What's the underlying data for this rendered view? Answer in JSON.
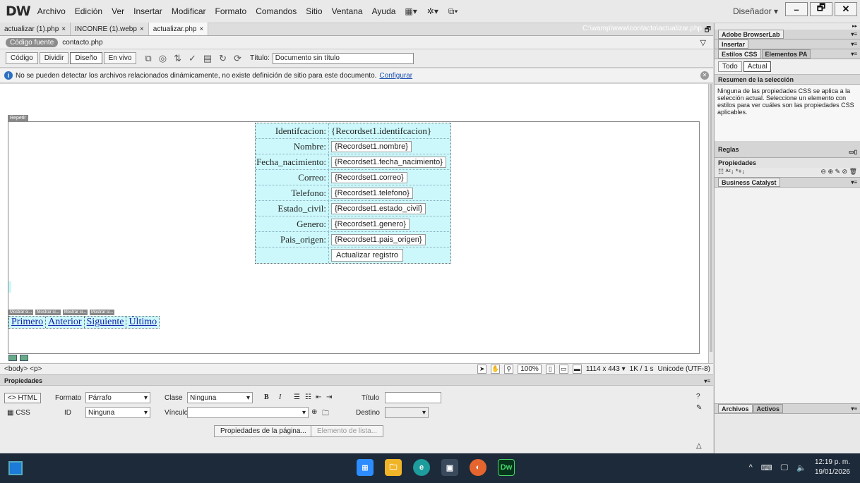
{
  "menubar": {
    "logo": "DW",
    "items": [
      "Archivo",
      "Edición",
      "Ver",
      "Insertar",
      "Modificar",
      "Formato",
      "Comandos",
      "Sitio",
      "Ventana",
      "Ayuda"
    ],
    "workspace": "Diseñador ▾",
    "window_buttons": [
      "–",
      "🗗",
      "✕"
    ]
  },
  "tabs": {
    "items": [
      "actualizar (1).php",
      "INCONRE (1).webp",
      "actualizar.php"
    ],
    "path": "C:\\wamp\\www\\contacto\\actualizar.php"
  },
  "related": {
    "source_label": "Código fuente",
    "file": "contacto.php"
  },
  "doctoolbar": {
    "views": [
      "Código",
      "Dividir",
      "Diseño",
      "En vivo"
    ],
    "title_label": "Título:",
    "title_value": "Documento sin título"
  },
  "infobar": {
    "message": "No se pueden detectar los archivos relacionados dinámicamente, no existe definición de sitio para este documento.",
    "link": "Configurar"
  },
  "design": {
    "repeat_tag": "Repetir",
    "form_rows": [
      {
        "label": "Identifcacion:",
        "value": "{Recordset1.identifcacion}",
        "plain": true
      },
      {
        "label": "Nombre:",
        "value": "{Recordset1.nombre}"
      },
      {
        "label": "Fecha_nacimiento:",
        "value": "{Recordset1.fecha_nacimiento}"
      },
      {
        "label": "Correo:",
        "value": "{Recordset1.correo}"
      },
      {
        "label": "Telefono:",
        "value": "{Recordset1.telefono}"
      },
      {
        "label": "Estado_civil:",
        "value": "{Recordset1.estado_civil}"
      },
      {
        "label": "Genero:",
        "value": "{Recordset1.genero}"
      },
      {
        "label": "Pais_origen:",
        "value": "{Recordset1.pais_origen}"
      }
    ],
    "submit_label": "Actualizar registro",
    "nav_tags": [
      "Mostrar si...",
      "Mostrar si...",
      "Mostrar si...",
      "Mostrar si..."
    ],
    "nav_links": [
      "Primero",
      "Anterior",
      "Siguiente",
      "Último"
    ]
  },
  "statusbar": {
    "tags": "<body> <p>",
    "zoom": "100%",
    "size": "1114 x 443 ▾",
    "weight": "1K / 1 s",
    "encoding": "Unicode (UTF-8)"
  },
  "props": {
    "header": "Propiedades",
    "html_btn": "<> HTML",
    "css_btn": "CSS",
    "format_label": "Formato",
    "format_value": "Párrafo",
    "class_label": "Clase",
    "class_value": "Ninguna",
    "id_label": "ID",
    "id_value": "Ninguna",
    "link_label": "Vínculo",
    "title_label": "Título",
    "target_label": "Destino",
    "page_props_btn": "Propiedades de la página...",
    "list_item_btn": "Elemento de lista..."
  },
  "right_panel": {
    "browserlab": "Adobe BrowserLab",
    "insert": "Insertar",
    "css_tab": "Estilos CSS",
    "pa_tab": "Elementos PA",
    "todo_btn": "Todo",
    "current_btn": "Actual",
    "summary_title": "Resumen de la selección",
    "summary_text": "Ninguna de las propiedades CSS se aplica a la selección actual. Seleccione un elemento con estilos para ver cuáles son las propiedades CSS aplicables.",
    "rules": "Reglas",
    "properties": "Propiedades",
    "business": "Business Catalyst",
    "files_tab": "Archivos",
    "assets_tab": "Activos"
  },
  "taskbar": {
    "time": "12:19 p. m.",
    "date": "19/01/2026",
    "dw_app": "Dw"
  }
}
